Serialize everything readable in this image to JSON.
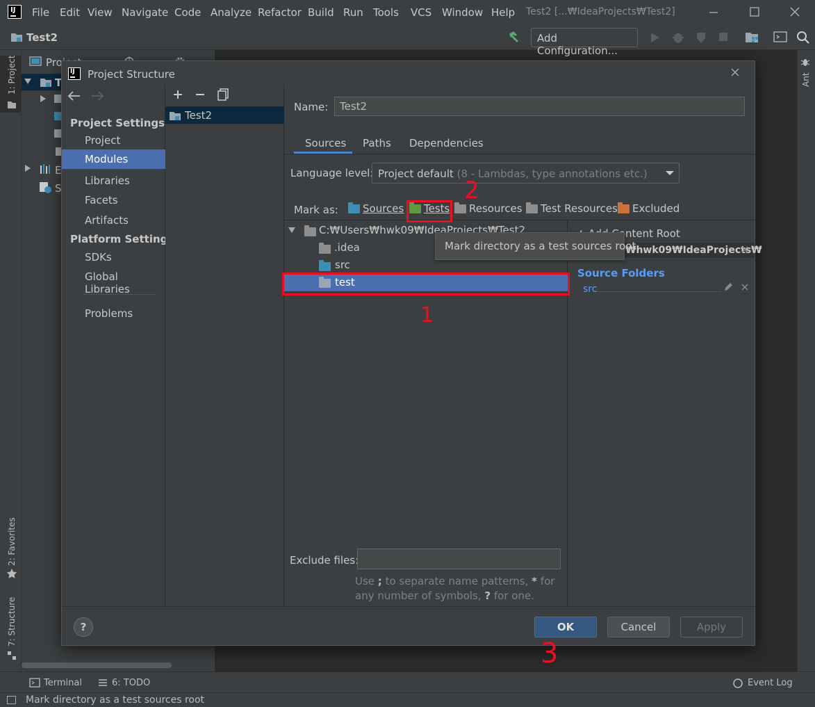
{
  "menubar": {
    "items": [
      "File",
      "Edit",
      "View",
      "Navigate",
      "Code",
      "Analyze",
      "Refactor",
      "Build",
      "Run",
      "Tools",
      "VCS",
      "Window",
      "Help"
    ],
    "window_title": "Test2 [...₩IdeaProjects₩Test2]",
    "logo": "IJ"
  },
  "navbar": {
    "project": "Test2",
    "add_configuration": "Add Configuration..."
  },
  "left_strip": {
    "project_tab": "1: Project",
    "favorites_tab": "2: Favorites",
    "structure_tab": "7: Structure"
  },
  "right_strip": {
    "ant_tab": "Ant"
  },
  "project_panel": {
    "header": "Project",
    "row_root": "T",
    "row_ext": "E",
    "row_scratch": "S"
  },
  "toolwindows": {
    "terminal": "Terminal",
    "todo": "6: TODO",
    "event_log": "Event Log"
  },
  "status": {
    "text": "Mark directory as a test sources root"
  },
  "dialog": {
    "title": "Project Structure",
    "logo": "IJ",
    "nav": {
      "project_settings": "Project Settings",
      "items_project": [
        "Project",
        "Modules",
        "Libraries",
        "Facets",
        "Artifacts"
      ],
      "platform_settings": "Platform Settings",
      "items_platform": [
        "SDKs",
        "Global Libraries"
      ],
      "problems": "Problems",
      "selected": "Modules"
    },
    "modules": [
      "Test2"
    ],
    "name_label": "Name:",
    "name_value": "Test2",
    "tabs": [
      "Sources",
      "Paths",
      "Dependencies"
    ],
    "active_tab": "Sources",
    "language_label": "Language level:",
    "language_value": "Project default",
    "language_hint": "(8 - Lambdas, type annotations etc.)",
    "mark_as_label": "Mark as:",
    "mark_as": [
      {
        "label": "Sources",
        "color": "#3d8fb5"
      },
      {
        "label": "Tests",
        "color": "#5b9b3e"
      },
      {
        "label": "Resources",
        "color": "#8e8e8e"
      },
      {
        "label": "Test Resources",
        "color": "#8e8e8e"
      },
      {
        "label": "Excluded",
        "color": "#d0703a"
      }
    ],
    "tree": {
      "root": "C:₩Users₩hwk09₩IdeaProjects₩Test2",
      "children": [
        ".idea",
        "src",
        "test"
      ],
      "selected": "test"
    },
    "tooltip": "Mark directory as a test sources root",
    "add_content_root": "Add Content Root",
    "content_root_path": "₩hwk09₩IdeaProjects₩",
    "source_folders_label": "Source Folders",
    "source_folders": [
      "src"
    ],
    "exclude_label": "Exclude files:",
    "exclude_value": "",
    "exclude_hint_a": "Use ",
    "exclude_hint_b": ";",
    "exclude_hint_c": " to separate name patterns, ",
    "exclude_hint_d": "*",
    "exclude_hint_e": " for any number of symbols, ",
    "exclude_hint_f": "?",
    "exclude_hint_g": " for one.",
    "help": "?",
    "ok": "OK",
    "cancel": "Cancel",
    "apply": "Apply"
  },
  "annotations": {
    "step1": "1",
    "step2": "2",
    "step3": "3"
  },
  "colors": {
    "accent": "#4b6eaf",
    "annotation": "#e81123",
    "source_folder": "#589df6"
  }
}
